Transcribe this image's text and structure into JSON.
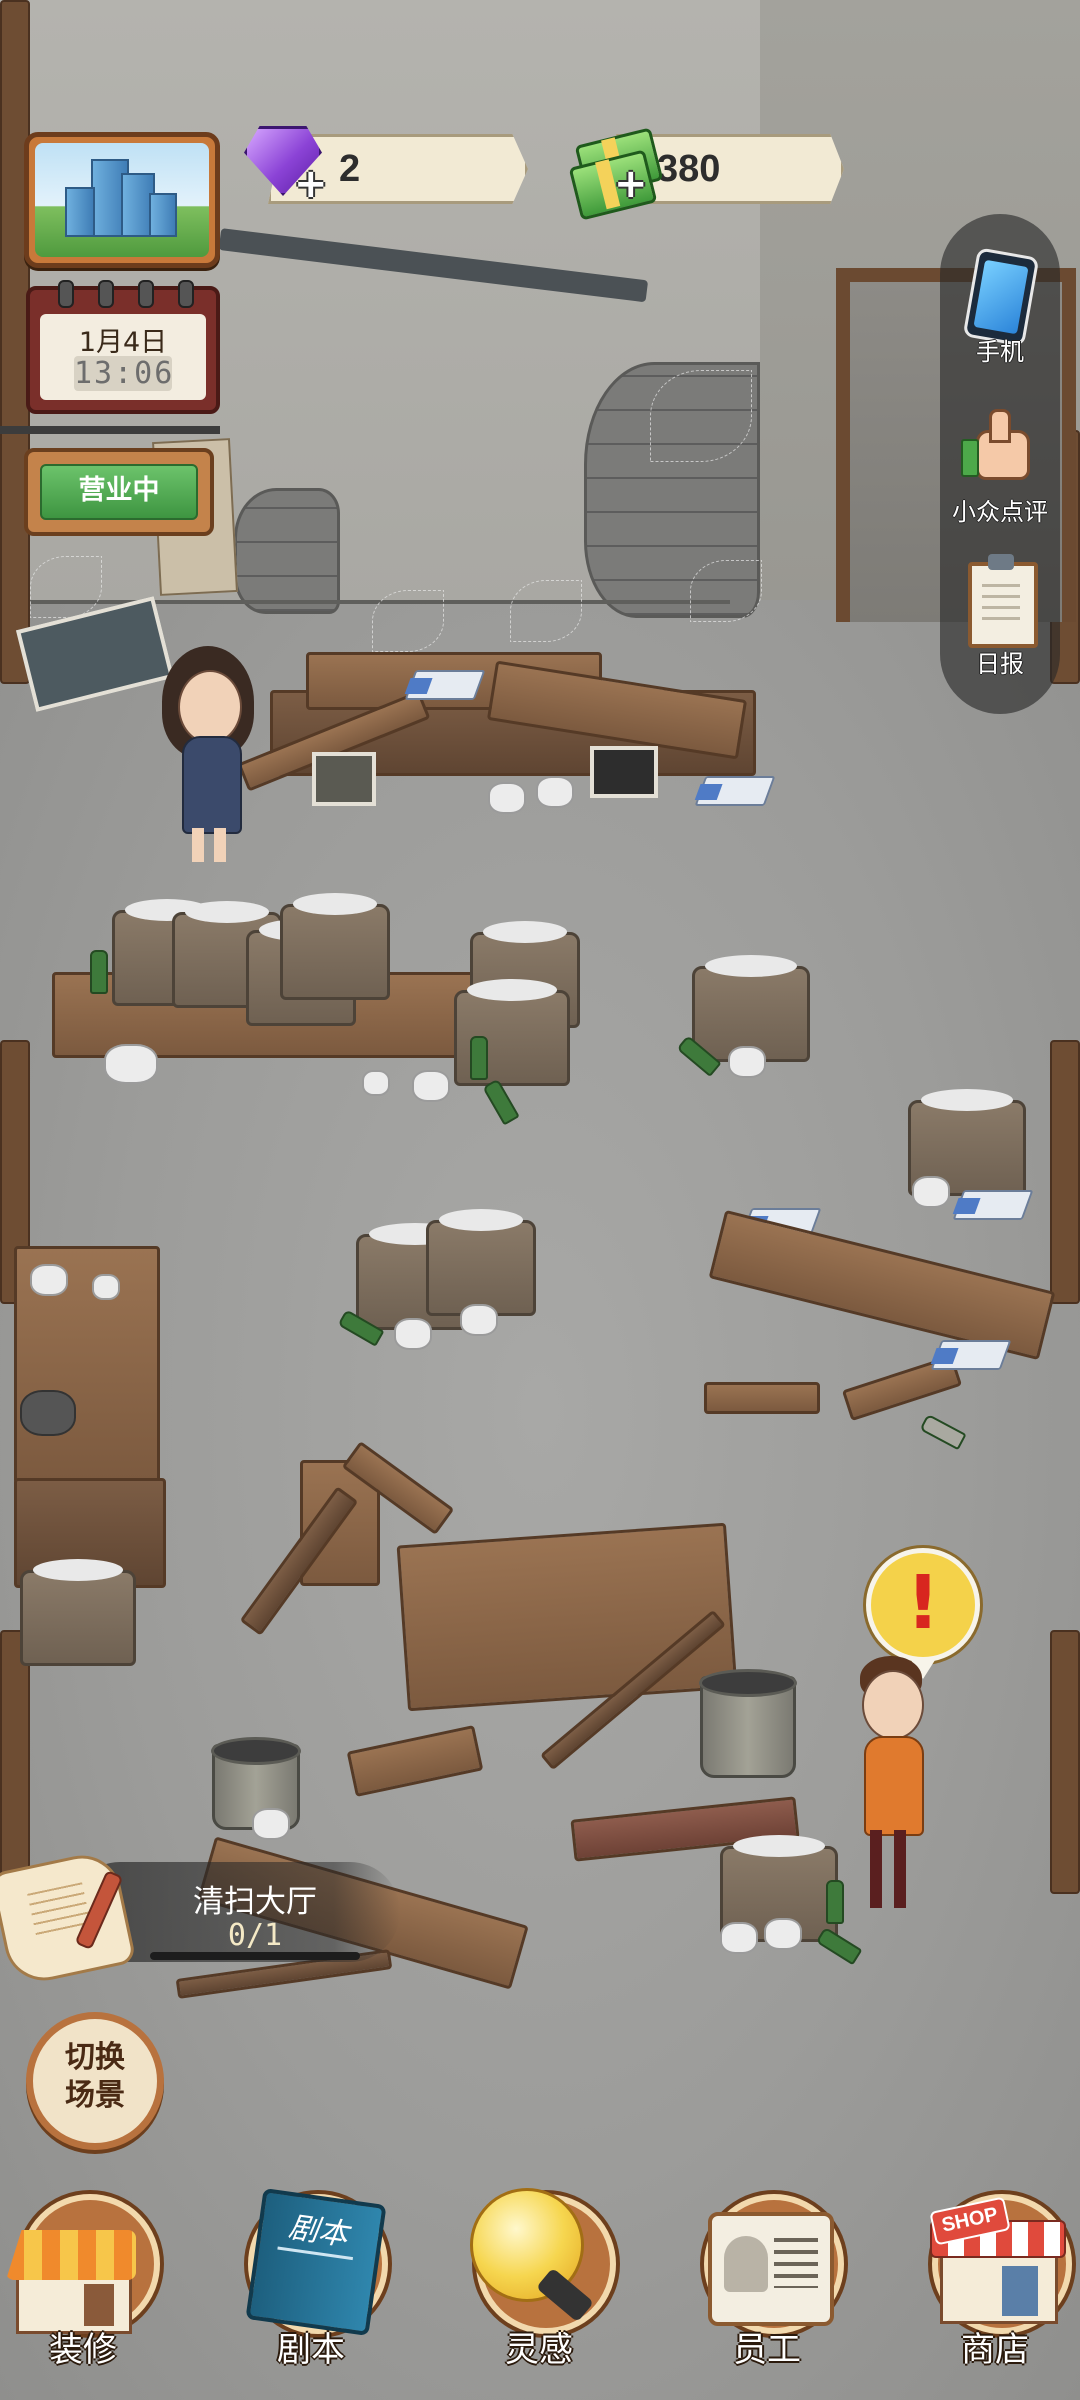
{
  "resources": {
    "gems": {
      "icon": "purple-gem-icon",
      "value": "2"
    },
    "cash": {
      "icon": "cash-stack-icon",
      "value": "380"
    }
  },
  "calendar": {
    "date": "1月4日",
    "time": "13:06"
  },
  "business_sign": {
    "label": "营业中",
    "color": "#4fab4d"
  },
  "side_menu": [
    {
      "label": "手机",
      "icon": "phone-icon"
    },
    {
      "label": "小众点评",
      "icon": "thumbs-up-icon"
    },
    {
      "label": "日报",
      "icon": "clipboard-report-icon"
    }
  ],
  "task": {
    "title": "清扫大厅",
    "progress": "0/1",
    "fraction": 0
  },
  "switch_scene": {
    "label": "切换场景",
    "line1": "切换",
    "line2": "场景"
  },
  "alert": {
    "mark": "!"
  },
  "bottom_nav": [
    {
      "label": "装修",
      "icon": "house-renovation-icon"
    },
    {
      "label": "剧本",
      "icon": "script-book-icon",
      "book_title": "剧本"
    },
    {
      "label": "灵感",
      "icon": "lightbulb-icon"
    },
    {
      "label": "员工",
      "icon": "staff-badge-icon"
    },
    {
      "label": "商店",
      "icon": "shop-icon",
      "shop_text": "SHOP"
    }
  ],
  "colors": {
    "accent_wood": "#b8723e",
    "gem_purple": "#8b43d6",
    "cash_green": "#3f9a3a",
    "alert_yellow": "#f4d24a",
    "alert_red": "#d8261f"
  }
}
